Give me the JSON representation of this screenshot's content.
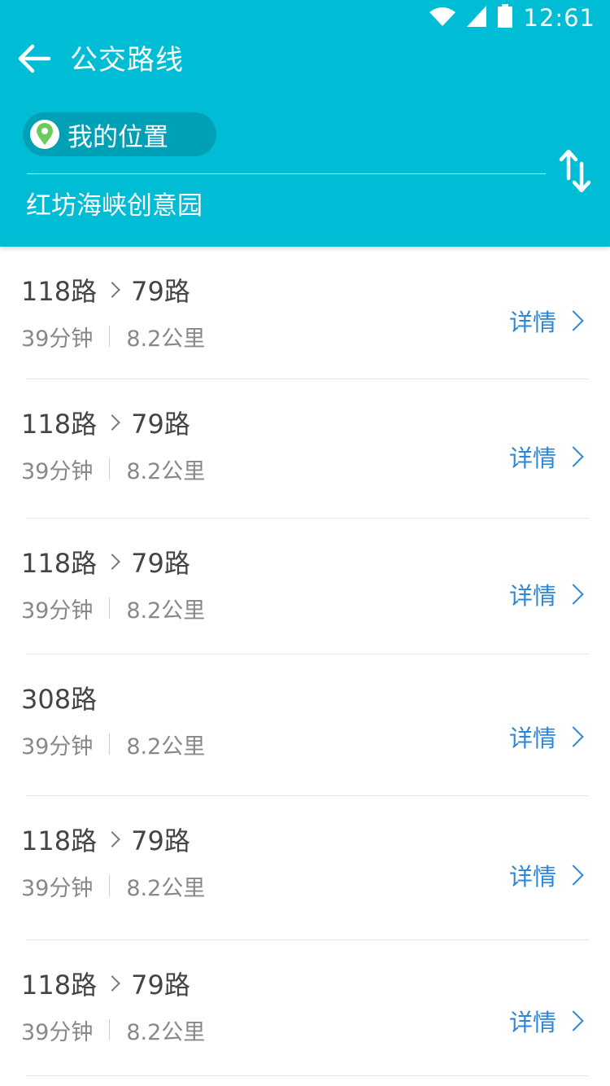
{
  "status_bar": {
    "time": "12:61",
    "icons": [
      "wifi-icon",
      "cell-signal-icon",
      "battery-icon"
    ]
  },
  "header": {
    "title": "公交路线",
    "from_label": "我的位置",
    "to_label": "红坊海峡创意园",
    "icons": [
      "back-arrow-icon",
      "location-pin-icon",
      "swap-icon"
    ]
  },
  "colors": {
    "header_bg": "#00bcd4",
    "pin_green": "#6ccb5a",
    "link_blue": "#2f86d6",
    "text_dark": "#444444",
    "text_gray": "#888888"
  },
  "routes": [
    {
      "segments": [
        "118路",
        "79路"
      ],
      "duration": "39分钟",
      "distance": "8.2公里",
      "detail_label": "详情"
    },
    {
      "segments": [
        "118路",
        "79路"
      ],
      "duration": "39分钟",
      "distance": "8.2公里",
      "detail_label": "详情"
    },
    {
      "segments": [
        "118路",
        "79路"
      ],
      "duration": "39分钟",
      "distance": "8.2公里",
      "detail_label": "详情"
    },
    {
      "segments": [
        "308路"
      ],
      "duration": "39分钟",
      "distance": "8.2公里",
      "detail_label": "详情"
    },
    {
      "segments": [
        "118路",
        "79路"
      ],
      "duration": "39分钟",
      "distance": "8.2公里",
      "detail_label": "详情"
    },
    {
      "segments": [
        "118路",
        "79路"
      ],
      "duration": "39分钟",
      "distance": "8.2公里",
      "detail_label": "详情"
    }
  ]
}
